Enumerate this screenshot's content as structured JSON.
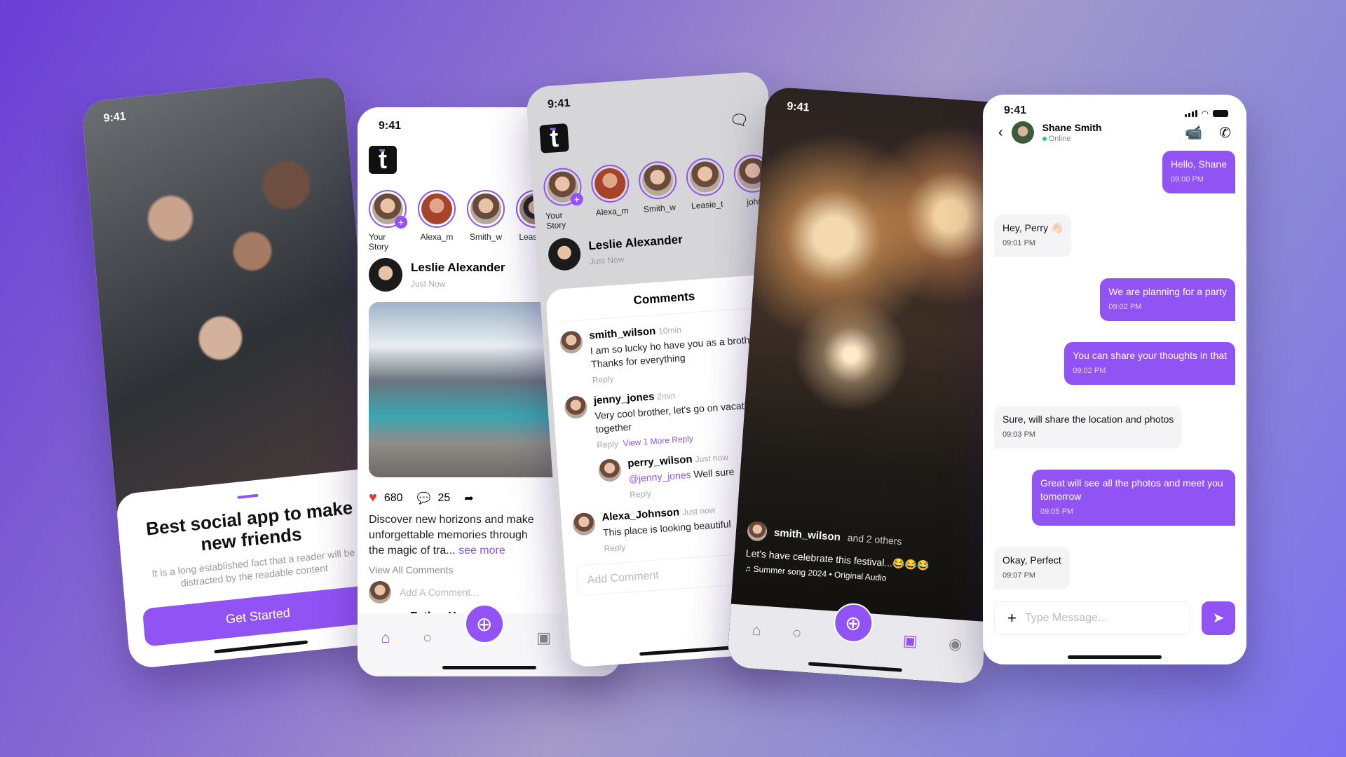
{
  "colors": {
    "accent": "#9153f4",
    "background": "#7a5cd6"
  },
  "status_time": "9:41",
  "onboarding": {
    "title": "Best social app to make new friends",
    "body": "It is a long established fact that a reader will be distracted by the readable content",
    "cta": "Get Started"
  },
  "feed": {
    "stories": [
      {
        "label": "Your Story"
      },
      {
        "label": "Alexa_m"
      },
      {
        "label": "Smith_w"
      },
      {
        "label": "Leasie_t"
      }
    ],
    "post": {
      "author": "Leslie Alexander",
      "time": "Just Now",
      "likes": "680",
      "comments": "25",
      "caption": "Discover new horizons and make unforgettable memories through the magic of tra...",
      "see_more": "see more",
      "view_all": "View All Comments",
      "add_comment_placeholder": "Add A Comment...",
      "next_author": "Esther Howard"
    }
  },
  "comments_screen": {
    "stories": [
      {
        "label": "Your Story"
      },
      {
        "label": "Alexa_m"
      },
      {
        "label": "Smith_w"
      },
      {
        "label": "Leasie_t"
      },
      {
        "label": "john"
      }
    ],
    "post_author": "Leslie Alexander",
    "post_time": "Just Now",
    "title": "Comments",
    "comments": [
      {
        "user": "smith_wilson",
        "time": "10min",
        "text": "I am so lucky ho have you as a brother. Thanks for everything",
        "reply": "Reply"
      },
      {
        "user": "jenny_jones",
        "time": "2min",
        "text": "Very cool brother, let's go on vacation together",
        "reply": "Reply",
        "more": "View 1 More Reply"
      },
      {
        "user": "perry_wilson",
        "time": "Just now",
        "mention": "@jenny_jones",
        "text": "Well sure",
        "reply": "Reply"
      },
      {
        "user": "Alexa_Johnson",
        "time": "Just now",
        "text": "This place is looking beautiful",
        "reply": "Reply"
      }
    ],
    "add_comment_placeholder": "Add Comment"
  },
  "reel": {
    "user": "smith_wilson",
    "others": "and 2 others",
    "caption": "Let's have celebrate this festival...😂😂😂",
    "audio": "Summer song 2024 • Original Audio"
  },
  "chat": {
    "contact": "Shane Smith",
    "status": "Online",
    "input_placeholder": "Type Message...",
    "messages": [
      {
        "dir": "out",
        "text": "Hello, Shane",
        "time": "09:00 PM"
      },
      {
        "dir": "in",
        "text": "Hey, Perry 👋🏻",
        "time": "09:01 PM"
      },
      {
        "dir": "out",
        "text": "We are planning for a party",
        "time": "09:02 PM"
      },
      {
        "dir": "out",
        "text": "You can share your thoughts in that",
        "time": "09:02 PM"
      },
      {
        "dir": "in",
        "text": "Sure, will share the location and photos",
        "time": "09:03 PM"
      },
      {
        "dir": "out",
        "text": "Great will see all the photos and meet you tomorrow",
        "time": "09:05 PM"
      },
      {
        "dir": "in",
        "text": "Okay, Perfect",
        "time": "09:07 PM"
      }
    ]
  }
}
